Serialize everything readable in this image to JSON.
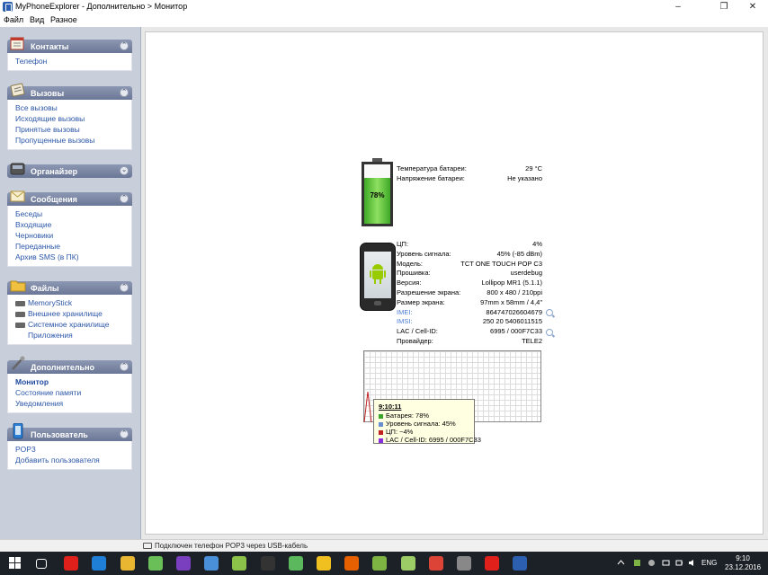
{
  "window": {
    "title": "MyPhoneExplorer - Дополнительно > Монитор",
    "minimize": "–",
    "maximize": "❐",
    "close": "✕"
  },
  "menu": [
    "Файл",
    "Вид",
    "Разное"
  ],
  "sidebar": {
    "sections": [
      {
        "label": "Контакты",
        "icon": "contacts-icon",
        "items": [
          {
            "label": "Телефон"
          }
        ]
      },
      {
        "label": "Вызовы",
        "icon": "calls-icon",
        "items": [
          {
            "label": "Все вызовы"
          },
          {
            "label": "Исходящие вызовы"
          },
          {
            "label": "Принятые вызовы"
          },
          {
            "label": "Пропущенные вызовы"
          }
        ]
      },
      {
        "label": "Органайзер",
        "icon": "organizer-icon",
        "items": []
      },
      {
        "label": "Сообщения",
        "icon": "messages-icon",
        "items": [
          {
            "label": "Беседы"
          },
          {
            "label": "Входящие"
          },
          {
            "label": "Черновики"
          },
          {
            "label": "Переданные"
          },
          {
            "label": "Архив SMS (в ПК)"
          }
        ]
      },
      {
        "label": "Файлы",
        "icon": "files-icon",
        "items": [
          {
            "label": "MemoryStick"
          },
          {
            "label": "Внешнее хранилище"
          },
          {
            "label": "Системное хранилище"
          },
          {
            "label": "Приложения"
          }
        ]
      },
      {
        "label": "Дополнительно",
        "icon": "extras-icon",
        "items": [
          {
            "label": "Монитор"
          },
          {
            "label": "Состояние памяти"
          },
          {
            "label": "Уведомления"
          }
        ]
      },
      {
        "label": "Пользователь",
        "icon": "user-icon",
        "items": [
          {
            "label": "POP3"
          },
          {
            "label": "Добавить пользователя"
          }
        ]
      }
    ]
  },
  "battery": {
    "percent_label": "78%",
    "level": 0.78,
    "fill_color": "#4cc232",
    "temp_label": "Температура батареи:",
    "temp_value": "29 °C",
    "voltage_label": "Напряжение батареи:",
    "voltage_value": "Не указано"
  },
  "device": [
    {
      "k": "ЦП:",
      "v": "4%"
    },
    {
      "k": "Уровень сигнала:",
      "v": "45% (-85 dBm)"
    },
    {
      "k": "Модель:",
      "v": "TCT ONE TOUCH POP C3"
    },
    {
      "k": "Прошивка:",
      "v": "userdebug"
    },
    {
      "k": "Версия:",
      "v": "Lollipop MR1 (5.1.1)"
    },
    {
      "k": "Разрешение экрана:",
      "v": "800 x 480  /  210ppi"
    },
    {
      "k": "Размер экрана:",
      "v": "97mm x 58mm  /  4,4\""
    },
    {
      "k": "IMEI:",
      "v": "864747026604679",
      "link": true
    },
    {
      "k": "IMSI:",
      "v": "250 20 5406011515",
      "link": true
    },
    {
      "k": "LAC / Cell-ID:",
      "v": "6995 / 000F7C33"
    },
    {
      "k": "Провайдер:",
      "v": "TELE2"
    }
  ],
  "tooltip": {
    "time": "9:10:11",
    "lines": [
      {
        "text": "Батарея: 78%",
        "color": "#3aa52a"
      },
      {
        "text": "Уровень сигнала: 45%",
        "color": "#6a8fd0"
      },
      {
        "text": "ЦП: ~4%",
        "color": "#c02020"
      },
      {
        "text": "LAC / Cell-ID: 6995 / 000F7C33",
        "color": "#8a2be2"
      }
    ]
  },
  "statusbar": {
    "text": "Подключен телефон POP3 через USB-кабель"
  },
  "taskbar": {
    "lang": "ENG",
    "time": "9:10",
    "date": "23.12.2016",
    "apps": [
      {
        "name": "task-view-icon",
        "color": "#ffffff"
      },
      {
        "name": "yandex-browser-icon",
        "color": "#e0201b"
      },
      {
        "name": "edge-icon",
        "color": "#1f7fd6"
      },
      {
        "name": "file-explorer-icon",
        "color": "#e8b631"
      },
      {
        "name": "usb-tool-icon",
        "color": "#6bbf59"
      },
      {
        "name": "purple-app-icon",
        "color": "#7a3fbf"
      },
      {
        "name": "search-tool-icon",
        "color": "#4a90d9"
      },
      {
        "name": "android-icon",
        "color": "#8bc34a"
      },
      {
        "name": "terminal-icon",
        "color": "#333333"
      },
      {
        "name": "green-arrow-icon",
        "color": "#5cb85c"
      },
      {
        "name": "linux-icon",
        "color": "#f0c020"
      },
      {
        "name": "firefox-icon",
        "color": "#e66000"
      },
      {
        "name": "android2-icon",
        "color": "#7cb342"
      },
      {
        "name": "android3-icon",
        "color": "#9ccc65"
      },
      {
        "name": "chrome-icon",
        "color": "#db4437"
      },
      {
        "name": "settings-icon",
        "color": "#888888"
      },
      {
        "name": "yandex2-icon",
        "color": "#e0201b"
      },
      {
        "name": "myphoneexplorer-icon",
        "color": "#2d5fb0"
      }
    ]
  }
}
